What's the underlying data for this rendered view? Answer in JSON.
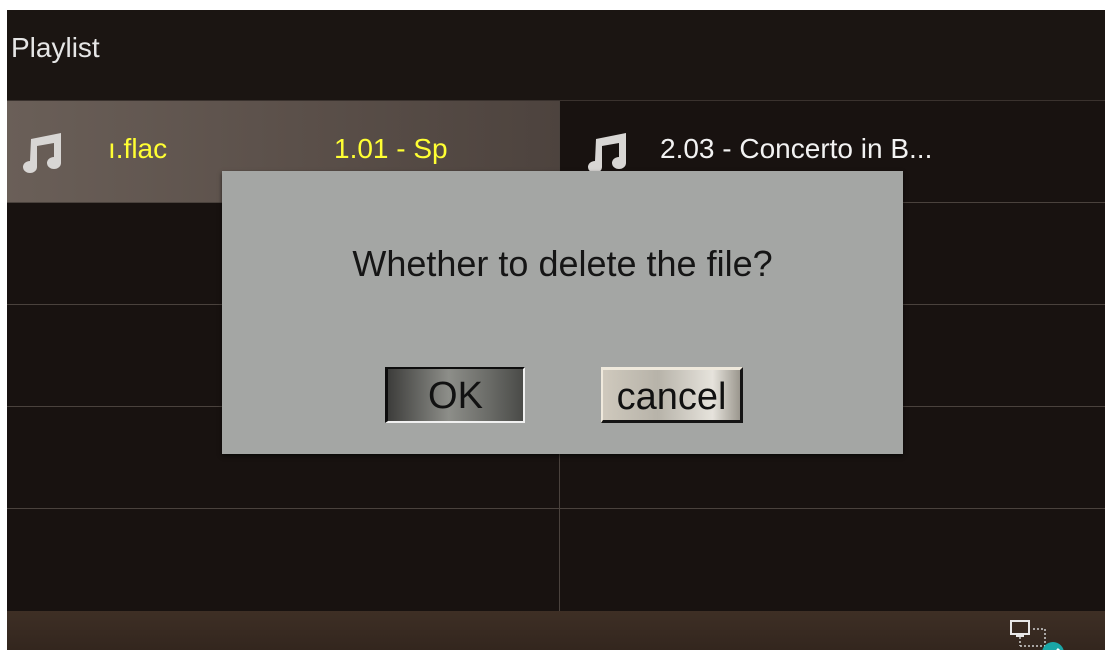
{
  "title": "Playlist",
  "playlist": {
    "item1": {
      "icon": "music-note-icon",
      "filename_fragment": "ı.flac",
      "track_fragment": "1.01 - Sp"
    },
    "item2": {
      "icon": "music-note-icon",
      "label": "2.03 - Concerto in B..."
    }
  },
  "dialog": {
    "message": "Whether to delete the file?",
    "ok_label": "OK",
    "cancel_label": "cancel"
  },
  "status_bar": {
    "icon": "network-connected-icon"
  },
  "colors": {
    "background": "#181210",
    "selected_text": "#ffff33",
    "normal_text": "#f2f2f2",
    "dialog_bg": "#a4a6a4",
    "status_bar": "#3a2c23",
    "badge": "#1aa6a6"
  }
}
